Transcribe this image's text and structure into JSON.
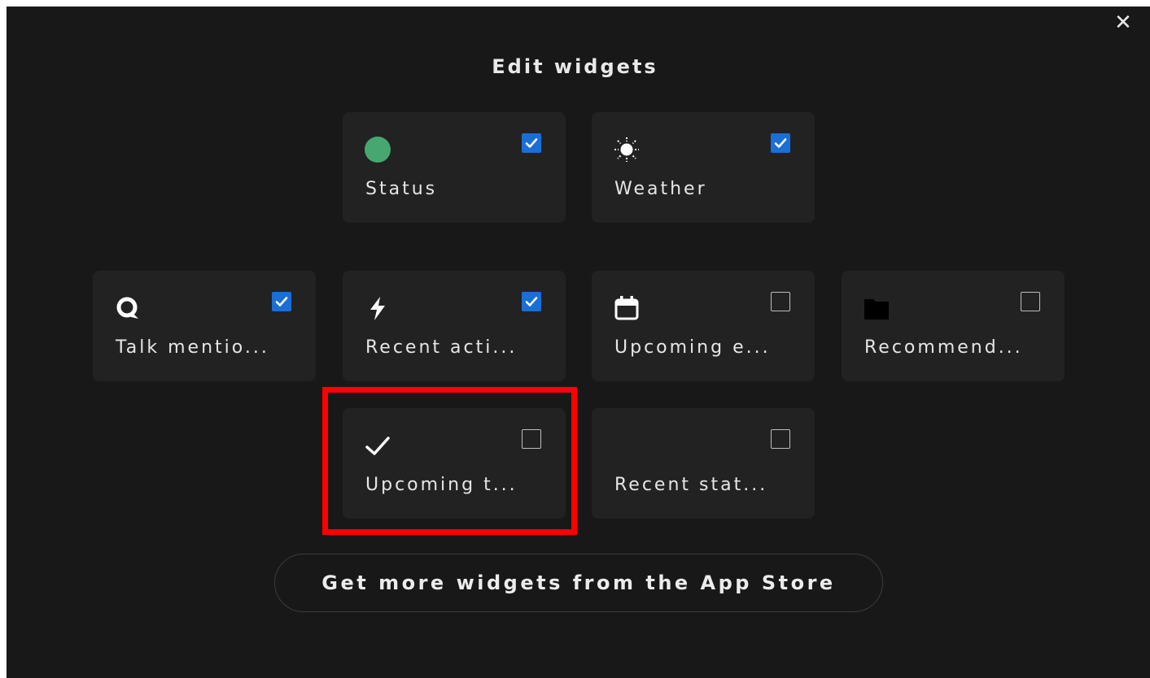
{
  "dialog": {
    "title": "Edit widgets",
    "close_glyph": "✕"
  },
  "widgets": [
    {
      "label": "Status",
      "icon": "status-dot-icon",
      "checked": true
    },
    {
      "label": "Weather",
      "icon": "sun-icon",
      "checked": true
    },
    {
      "label": "Talk mentio...",
      "icon": "talk-icon",
      "checked": true
    },
    {
      "label": "Recent acti...",
      "icon": "lightning-icon",
      "checked": true
    },
    {
      "label": "Upcoming e...",
      "icon": "calendar-icon",
      "checked": false
    },
    {
      "label": "Recommend...",
      "icon": "folder-icon",
      "checked": false
    },
    {
      "label": "Upcoming t...",
      "icon": "checkmark-icon",
      "checked": false
    },
    {
      "label": "Recent stat...",
      "icon": "",
      "checked": false
    }
  ],
  "store_button": {
    "label": "Get more widgets from the App Store"
  },
  "colors": {
    "background": "#181818",
    "card": "#222222",
    "checkbox_checked": "#1a6fd6",
    "status_green": "#46a870",
    "highlight": "#ff0000"
  }
}
